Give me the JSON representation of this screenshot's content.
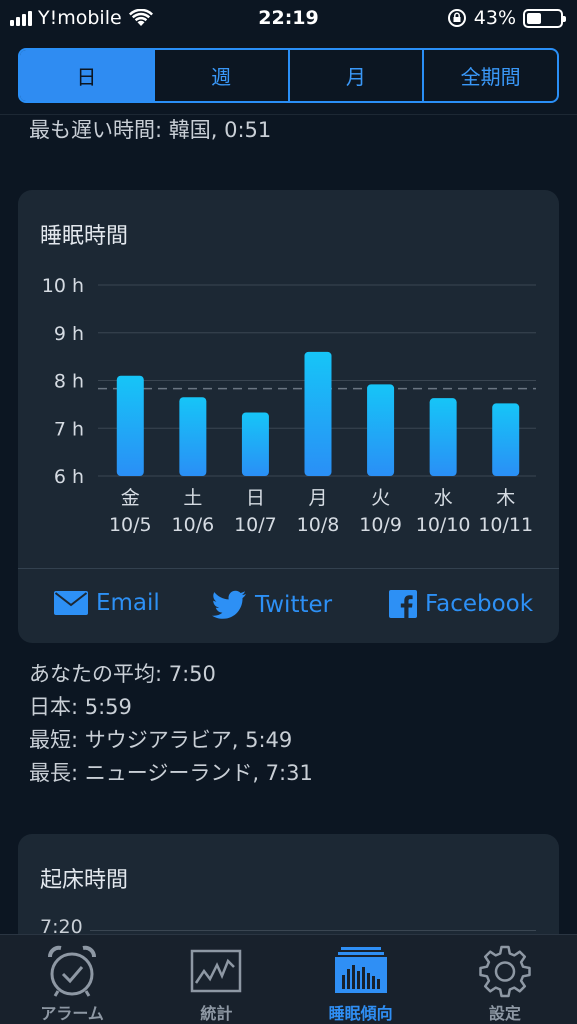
{
  "status_bar": {
    "carrier": "Y!mobile",
    "time": "22:19",
    "battery": "43%",
    "battery_level": 0.43
  },
  "segmented": {
    "day": "日",
    "week": "週",
    "month": "月",
    "all": "全期間",
    "selected": "日"
  },
  "latest_line": "最も遅い時間: 韓国, 0:51",
  "sleep_card": {
    "title": "睡眠時間",
    "share": {
      "email": "Email",
      "twitter": "Twitter",
      "facebook": "Facebook"
    }
  },
  "chart_data": {
    "type": "bar",
    "title": "睡眠時間",
    "categories": [
      "金\n10/5",
      "土\n10/6",
      "日\n10/7",
      "月\n10/8",
      "火\n10/9",
      "水\n10/10",
      "木\n10/11"
    ],
    "weekdays": [
      "金",
      "土",
      "日",
      "月",
      "火",
      "水",
      "木"
    ],
    "dates": [
      "10/5",
      "10/6",
      "10/7",
      "10/8",
      "10/9",
      "10/10",
      "10/11"
    ],
    "values": [
      8.1,
      7.65,
      7.33,
      8.6,
      7.92,
      7.63,
      7.52
    ],
    "y_ticks": [
      "6 h",
      "7 h",
      "8 h",
      "9 h",
      "10 h"
    ],
    "ylim": [
      6,
      10
    ],
    "average_line": 7.83,
    "grid": true,
    "bar_colors": [
      "#16c5f7",
      "#2a8ff6"
    ]
  },
  "averages": {
    "you": "あなたの平均: 7:50",
    "japan": "日本: 5:59",
    "shortest": "最短: サウジアラビア, 5:49",
    "longest": "最長: ニュージーランド, 7:31"
  },
  "wake_card": {
    "title": "起床時間",
    "first_tick": "7:20"
  },
  "tabbar": {
    "alarm": "アラーム",
    "stats": "統計",
    "trends": "睡眠傾向",
    "settings": "設定",
    "active": "睡眠傾向"
  },
  "colors": {
    "accent": "#2f8cf2",
    "background": "#0c1622",
    "card": "#1c2834"
  }
}
